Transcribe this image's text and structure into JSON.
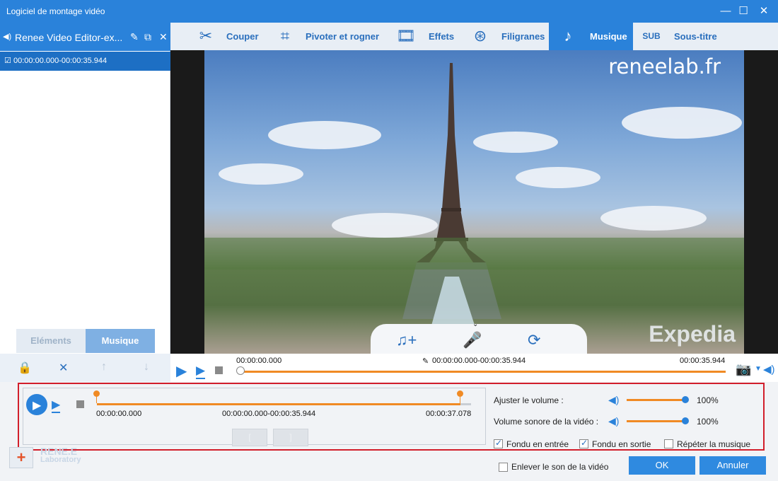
{
  "window": {
    "title": "Logiciel de montage vidéo"
  },
  "left_panel": {
    "file_name": "Renee Video Editor-ex...",
    "clip_range": "00:00:00.000-00:00:35.944",
    "tabs": [
      "Eléments",
      "Musique"
    ]
  },
  "tabs": [
    {
      "label": "Couper",
      "icon": "scissors-icon"
    },
    {
      "label": "Pivoter et rogner",
      "icon": "crop-rotate-icon"
    },
    {
      "label": "Effets",
      "icon": "effects-icon"
    },
    {
      "label": "Filigranes",
      "icon": "watermark-icon"
    },
    {
      "label": "Musique",
      "icon": "music-icon",
      "active": true
    },
    {
      "label": "Sous-titre",
      "icon": "subtitle-icon"
    }
  ],
  "preview": {
    "watermark": "reneelab.fr",
    "brand_overlay": "Expedia",
    "start_time": "00:00:00.000",
    "range": "00:00:00.000-00:00:35.944",
    "end_time": "00:00:35.944"
  },
  "music": {
    "start_time": "00:00:00.000",
    "range": "00:00:00.000-00:00:35.944",
    "end_time": "00:00:37.078",
    "volume_label": "Ajuster le volume :",
    "volume_value": "100%",
    "video_volume_label": "Volume sonore de la vidéo :",
    "video_volume_value": "100%",
    "fade_in": "Fondu en entrée",
    "fade_out": "Fondu en sortie",
    "repeat": "Répéter la musique"
  },
  "footer": {
    "remove_audio": "Enlever le son de la vidéo",
    "ok": "OK",
    "cancel": "Annuler",
    "logo_line1": "RENE.E",
    "logo_line2": "Laboratory"
  },
  "colors": {
    "accent": "#2a82da",
    "highlight": "#d21e2b",
    "track": "#f08a24"
  }
}
